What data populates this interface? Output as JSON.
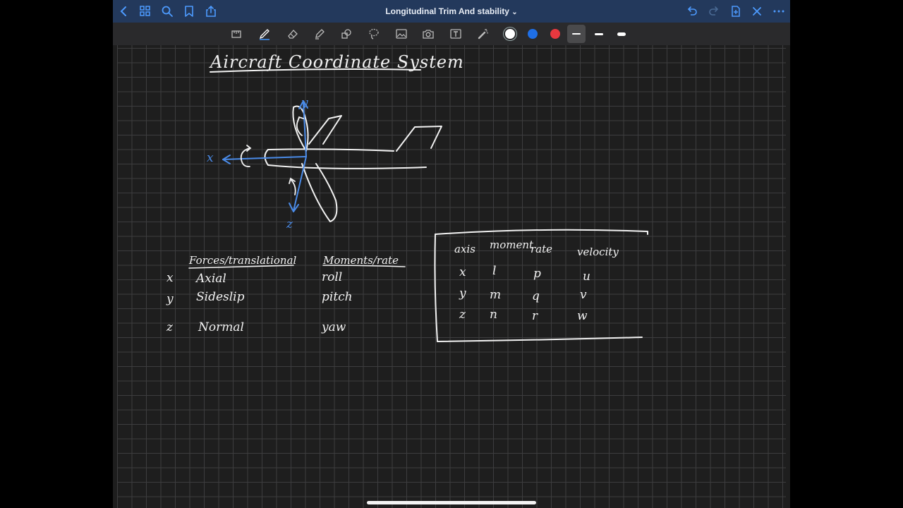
{
  "titlebar": {
    "title": "Longitudinal Trim And stability",
    "title_chevron": "⌄"
  },
  "colors": {
    "titlebar": "#23395c",
    "accent": "#3f8ef0",
    "ink": "#f2f2f2",
    "axis_blue": "#4a8be8",
    "pen_red": "#e8383f"
  },
  "toolbar": {
    "left_icons": [
      "back-icon",
      "grid-icon",
      "search-icon",
      "bookmark-icon",
      "share-icon"
    ],
    "right_icons": [
      "undo-icon",
      "redo-icon",
      "add-page-icon",
      "close-icon",
      "more-icon"
    ],
    "tools": [
      "ruler-icon",
      "pen-icon",
      "eraser-icon",
      "highlighter-icon",
      "shapes-icon",
      "lasso-icon",
      "image-icon",
      "camera-icon",
      "text-icon",
      "laser-icon"
    ],
    "colors": [
      "#ffffff",
      "#1f6fe6",
      "#e8383f"
    ],
    "selected_color": "#ffffff",
    "strokes": [
      "fine",
      "medium",
      "thick"
    ]
  },
  "notes": {
    "title": "Aircraft Coordinate System",
    "diagram": {
      "x_label": "x",
      "y_label": "y",
      "z_label": "z"
    },
    "left_table": {
      "col1": "Forces/translational",
      "col2": "Moments/rate",
      "rows": [
        {
          "axis": "x",
          "force": "Axial",
          "moment": "roll"
        },
        {
          "axis": "y",
          "force": "Sideslip",
          "moment": "pitch"
        },
        {
          "axis": "z",
          "force": "Normal",
          "moment": "yaw"
        }
      ]
    },
    "right_table": {
      "headers": [
        "axis",
        "moment",
        "rate",
        "velocity"
      ],
      "rows": [
        [
          "x",
          "l",
          "p",
          "u"
        ],
        [
          "y",
          "m",
          "q",
          "v"
        ],
        [
          "z",
          "n",
          "r",
          "w"
        ]
      ]
    }
  }
}
